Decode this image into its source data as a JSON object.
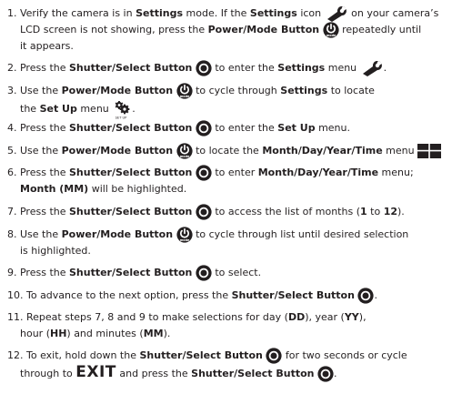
{
  "steps": [
    {
      "lines": [
        [
          {
            "t": "1. Verify the camera is in "
          },
          {
            "t": "Settings",
            "b": true
          },
          {
            "t": " mode. If the "
          },
          {
            "t": "Settings",
            "b": true
          },
          {
            "t": " icon "
          },
          {
            "icon": "wrench-icon"
          },
          {
            "t": " on your camera’s"
          }
        ],
        [
          {
            "t": "LCD screen is not showing, press the "
          },
          {
            "t": "Power/Mode Button",
            "b": true
          },
          {
            "t": " "
          },
          {
            "icon": "power-mode-button-icon",
            "label": "mode"
          },
          {
            "t": " repeatedly until"
          }
        ],
        [
          {
            "t": "it appears."
          }
        ]
      ]
    },
    {
      "lines": [
        [
          {
            "t": "2. Press the "
          },
          {
            "t": "Shutter/Select Button",
            "b": true
          },
          {
            "t": " "
          },
          {
            "icon": "shutter-select-button-icon"
          },
          {
            "t": " to enter the "
          },
          {
            "t": "Settings",
            "b": true
          },
          {
            "t": " menu "
          },
          {
            "icon": "wrench-icon"
          },
          {
            "t": "."
          }
        ]
      ]
    },
    {
      "lines": [
        [
          {
            "t": "3. Use the "
          },
          {
            "t": "Power/Mode Button",
            "b": true
          },
          {
            "t": " "
          },
          {
            "icon": "power-mode-button-icon",
            "label": "mode"
          },
          {
            "t": " to cycle through "
          },
          {
            "t": "Settings",
            "b": true
          },
          {
            "t": " to locate"
          }
        ],
        [
          {
            "t": "the "
          },
          {
            "t": "Set Up",
            "b": true
          },
          {
            "t": " menu "
          },
          {
            "icon": "setup-gears-icon",
            "label": "SET UP"
          },
          {
            "t": "."
          }
        ]
      ]
    },
    {
      "lines": [
        [
          {
            "t": "4. Press the "
          },
          {
            "t": "Shutter/Select Button",
            "b": true
          },
          {
            "t": " "
          },
          {
            "icon": "shutter-select-button-icon"
          },
          {
            "t": " to enter the "
          },
          {
            "t": "Set Up",
            "b": true
          },
          {
            "t": " menu."
          }
        ]
      ]
    },
    {
      "lines": [
        [
          {
            "t": "5. Use the "
          },
          {
            "t": "Power/Mode Button",
            "b": true
          },
          {
            "t": " "
          },
          {
            "icon": "power-mode-button-icon",
            "label": "mode"
          },
          {
            "t": " to locate the "
          },
          {
            "t": "Month/Day/Year/Time",
            "b": true
          },
          {
            "t": " menu "
          },
          {
            "icon": "date-time-grid-icon"
          }
        ]
      ]
    },
    {
      "lines": [
        [
          {
            "t": "6. Press the "
          },
          {
            "t": "Shutter/Select Button",
            "b": true
          },
          {
            "t": " "
          },
          {
            "icon": "shutter-select-button-icon"
          },
          {
            "t": " to enter "
          },
          {
            "t": "Month/Day/Year/Time",
            "b": true
          },
          {
            "t": " menu;"
          }
        ],
        [
          {
            "t": "Month (MM)",
            "b": true
          },
          {
            "t": " will be highlighted."
          }
        ]
      ]
    },
    {
      "lines": [
        [
          {
            "t": "7. Press the "
          },
          {
            "t": "Shutter/Select Button",
            "b": true
          },
          {
            "t": " "
          },
          {
            "icon": "shutter-select-button-icon"
          },
          {
            "t": " to access the list of months ("
          },
          {
            "t": "1",
            "b": true
          },
          {
            "t": " to "
          },
          {
            "t": "12",
            "b": true
          },
          {
            "t": ")."
          }
        ]
      ]
    },
    {
      "lines": [
        [
          {
            "t": "8. Use the "
          },
          {
            "t": "Power/Mode Button",
            "b": true
          },
          {
            "t": " "
          },
          {
            "icon": "power-mode-button-icon",
            "label": "mode"
          },
          {
            "t": " to cycle through list until desired selection"
          }
        ],
        [
          {
            "t": "is highlighted."
          }
        ]
      ]
    },
    {
      "lines": [
        [
          {
            "t": "9. Press the "
          },
          {
            "t": "Shutter/Select Button",
            "b": true
          },
          {
            "t": " "
          },
          {
            "icon": "shutter-select-button-icon"
          },
          {
            "t": " to select."
          }
        ]
      ]
    },
    {
      "lines": [
        [
          {
            "t": "10. To advance to the next option, press the "
          },
          {
            "t": "Shutter/Select Button",
            "b": true
          },
          {
            "t": " "
          },
          {
            "icon": "shutter-select-button-icon"
          },
          {
            "t": "."
          }
        ]
      ]
    },
    {
      "lines": [
        [
          {
            "t": "11. Repeat steps 7, 8 and 9 to make selections for day ("
          },
          {
            "t": "DD",
            "b": true
          },
          {
            "t": "), year ("
          },
          {
            "t": "YY",
            "b": true
          },
          {
            "t": "),"
          }
        ],
        [
          {
            "t": "hour ("
          },
          {
            "t": "HH",
            "b": true
          },
          {
            "t": ") and minutes ("
          },
          {
            "t": "MM",
            "b": true
          },
          {
            "t": ")."
          }
        ]
      ]
    },
    {
      "lines": [
        [
          {
            "t": "12. To exit, hold down the "
          },
          {
            "t": "Shutter/Select Button",
            "b": true
          },
          {
            "t": " "
          },
          {
            "icon": "shutter-select-button-icon"
          },
          {
            "t": " for two seconds or cycle"
          }
        ],
        [
          {
            "t": "through to "
          },
          {
            "t": "EXIT",
            "b": true,
            "big": true
          },
          {
            "t": " and press the "
          },
          {
            "t": "Shutter/Select Button",
            "b": true
          },
          {
            "t": " "
          },
          {
            "icon": "shutter-select-button-icon"
          },
          {
            "t": "."
          }
        ]
      ]
    }
  ]
}
